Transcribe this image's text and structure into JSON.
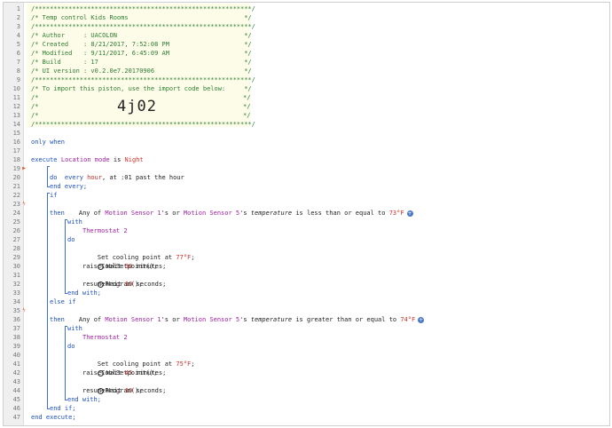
{
  "line_numbers": [
    "1",
    "2",
    "3",
    "4",
    "5",
    "6",
    "7",
    "8",
    "9",
    "10",
    "11",
    "12",
    "13",
    "14",
    "15",
    "16",
    "17",
    "18",
    "19",
    "20",
    "21",
    "22",
    "23",
    "24",
    "25",
    "26",
    "27",
    "28",
    "29",
    "30",
    "31",
    "32",
    "33",
    "34",
    "35",
    "36",
    "37",
    "38",
    "39",
    "40",
    "41",
    "42",
    "43",
    "44",
    "45",
    "46",
    "47"
  ],
  "header": {
    "border": "/**********************************************************/",
    "title": "/* Temp control Kids Rooms                               */",
    "author": "/* Author     : UACOLON                                  */",
    "created": "/* Created    : 8/21/2017, 7:52:08 PM                    */",
    "modified": "/* Modified   : 9/11/2017, 6:45:09 AM                    */",
    "build": "/* Build      : 17                                       */",
    "ui_version": "/* UI version : v0.2.0e7.20170906                        */",
    "import_text": "/* To import this piston, use the import code below:     */",
    "empty_open": "/*",
    "empty_close": "*/",
    "import_code": "4j02"
  },
  "code": {
    "only_when": "only when",
    "cond_device": "Location mode",
    "cond_is": " is ",
    "cond_value": "Night",
    "execute": "execute",
    "every_kw": "every",
    "every_unit": " hour",
    "every_rest": ", at :01 past the hour",
    "do": "do",
    "end_every": "end every;",
    "if": "if",
    "any_of": "Any of ",
    "sensor1": "Motion Sensor 1",
    "poss_or": "'s or ",
    "sensor5": "Motion Sensor 5",
    "poss": "'s ",
    "temperature": "temperature",
    "less_than": " is less than or equal to ",
    "val73": "73°F",
    "greater_than": " is greater than or equal to ",
    "val74": "74°F",
    "then": "then",
    "with": "with",
    "thermostat": "Thermostat 2",
    "set_cooling": "Set cooling point at ",
    "val77": "77°F",
    "val75": "75°F",
    "semicolon": ";",
    "wait": "Wait ",
    "wait30": "30",
    "wait45": "45",
    "minutes": " minutes;",
    "wait10": "10",
    "seconds": " seconds;",
    "raise": "raiseCoolSetpoint();",
    "resume": "resumeProgram();",
    "end_with": "end with;",
    "else_if": "else if",
    "end_if": "end if;",
    "end_execute": "end execute;"
  },
  "icons": {
    "flag_icon": "flag-icon",
    "lightning_icon": "lightning-icon",
    "clock_icon": "clock-icon",
    "add_icon": "add-condition-icon"
  },
  "colors": {
    "comment": "#2e7d32",
    "keyword": "#1d4fc4",
    "device": "#a020a0",
    "value": "#d0302a"
  }
}
